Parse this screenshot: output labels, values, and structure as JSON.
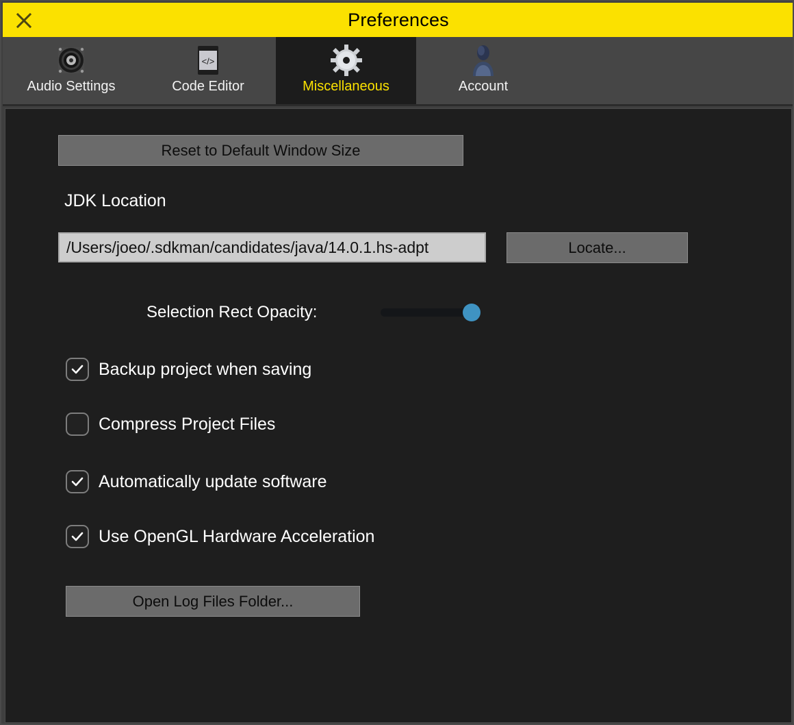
{
  "window": {
    "title": "Preferences",
    "close_icon": "close-icon",
    "title_bg": "#fbe100",
    "panel_bg": "#1e1e1e"
  },
  "tabs": [
    {
      "label": "Audio Settings",
      "icon": "speaker-icon",
      "selected": false
    },
    {
      "label": "Code Editor",
      "icon": "code-brackets-icon",
      "selected": false
    },
    {
      "label": "Miscellaneous",
      "icon": "gear-icon",
      "selected": true
    },
    {
      "label": "Account",
      "icon": "user-bust-icon",
      "selected": false
    }
  ],
  "main": {
    "reset_button": "Reset to Default Window Size",
    "jdk_label": "JDK Location",
    "jdk_path_value": "/Users/joeo/.sdkman/candidates/java/14.0.1.hs-adpt",
    "jdk_path_placeholder": "JDK path",
    "locate_button": "Locate...",
    "opacity_label": "Selection Rect Opacity:",
    "opacity_value": "100",
    "open_logs_button": "Open Log Files Folder...",
    "checkboxes": [
      {
        "label": "Backup project when saving",
        "checked": true
      },
      {
        "label": "Compress Project Files",
        "checked": false
      },
      {
        "label": "Automatically update software",
        "checked": true
      },
      {
        "label": "Use OpenGL Hardware Acceleration",
        "checked": true
      }
    ]
  },
  "colors": {
    "accent_yellow": "#fbe100",
    "slider_thumb_blue": "#3f93c2",
    "button_gray": "#6b6b6b",
    "field_gray": "#cdcdcd"
  }
}
